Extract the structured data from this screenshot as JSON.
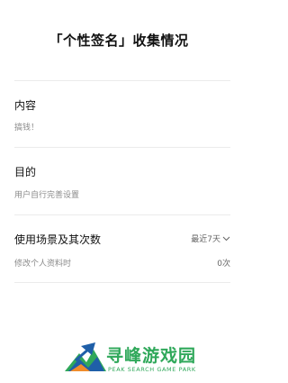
{
  "page": {
    "title": "「个性签名」收集情况"
  },
  "sections": {
    "content": {
      "label": "内容",
      "value": "搞钱！"
    },
    "purpose": {
      "label": "目的",
      "value": "用户自行完善设置"
    },
    "usage": {
      "label": "使用场景及其次数",
      "range": "最近7天",
      "scenario": "修改个人资料时",
      "count": "0次"
    }
  },
  "watermark": {
    "title": "寻峰游戏园",
    "subtitle": "PEAK SEARCH GAME PARK"
  },
  "colors": {
    "divider": "#ebebeb",
    "secondary_text": "#8a8a8a",
    "watermark_green": "#2fa85a",
    "watermark_blue": "#1f5fa8",
    "watermark_orange": "#f08c2b"
  },
  "icons": {
    "range_dropdown": "chevron-down-icon",
    "watermark_logo": "mountain-arrow-logo"
  }
}
